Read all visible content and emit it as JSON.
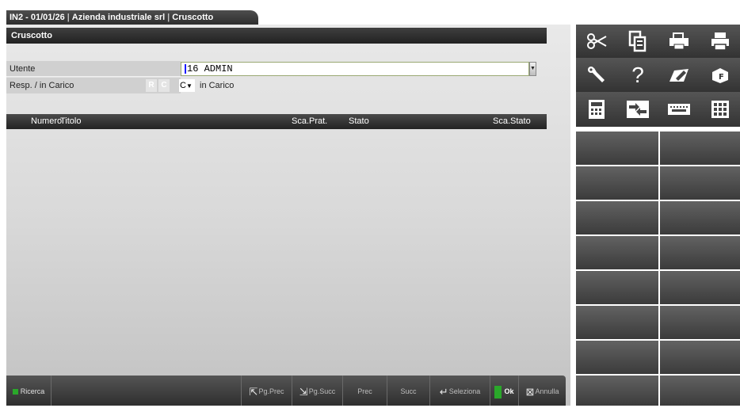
{
  "window": {
    "title_part1": "IN2 - 01/01/26",
    "title_part2": "Azienda industriale srl",
    "title_part3": "Cruscotto"
  },
  "form": {
    "title": "Cruscotto",
    "utente_label": "Utente",
    "utente_value": "16 ADMIN",
    "resp_label": "Resp. / in Carico",
    "btn_r": "R",
    "btn_c": "C",
    "resp_select_value": "C",
    "resp_select_text": "in Carico"
  },
  "table": {
    "columns": [
      "Numero",
      "Titolo",
      "Sca.Prat.",
      "Stato",
      "Sca.Stato"
    ],
    "rows": []
  },
  "bottombar": {
    "ricerca": "Ricerca",
    "pg_prec": "Pg.Prec",
    "pg_succ": "Pg.Succ",
    "prec": "Prec",
    "succ": "Succ",
    "seleziona": "Seleziona",
    "ok": "Ok",
    "annulla": "Annulla"
  },
  "toolbar_icons": [
    "scissors-icon",
    "copy-document-icon",
    "printer-tray-icon",
    "printer-icon",
    "wrench-icon",
    "help-icon",
    "edit-pencil-icon",
    "function-box-icon",
    "calculator-icon",
    "transfer-arrows-icon",
    "keyboard-icon",
    "grid-menu-icon"
  ],
  "colors": {
    "accent_green": "#2aa82a",
    "dark_bar": "#2e2e2e",
    "field_border": "#9aa873",
    "caret": "#1a1aff"
  }
}
